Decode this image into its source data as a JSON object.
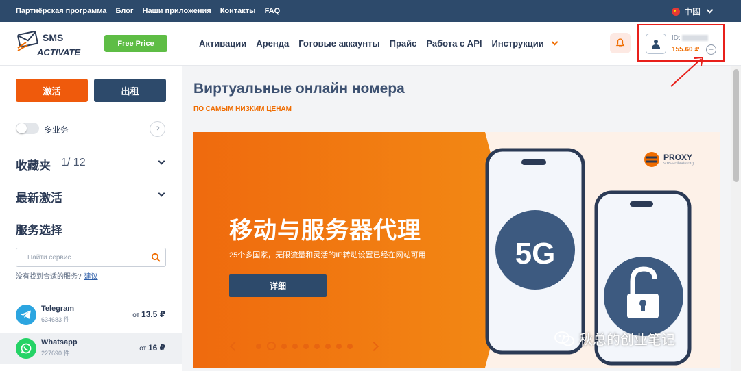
{
  "topbar": {
    "links": [
      "Партнёрская программа",
      "Блог",
      "Наши приложения",
      "Контакты",
      "FAQ"
    ],
    "language": "中國"
  },
  "header": {
    "logo_text": "SMS ACTIVATE",
    "free_price": "Free Price",
    "nav": [
      "Активации",
      "Аренда",
      "Готовые аккаунты",
      "Прайс",
      "Работа с API",
      "Инструкции"
    ],
    "account": {
      "id_label": "ID:",
      "balance": "155.60 ₽",
      "plus": "+"
    }
  },
  "sidebar": {
    "activate_label": "激活",
    "rent_label": "出租",
    "multi_service_label": "多业务",
    "help": "?",
    "favorites_title": "收藏夹",
    "favorites_count": "1/ 12",
    "recent_title": "最新激活",
    "service_select_title": "服务选择",
    "search_placeholder": "Найти сервис",
    "not_found_text": "没有找到合适的服务?",
    "suggest_link": "建议",
    "services": [
      {
        "name": "Telegram",
        "count": "634683 件",
        "price_prefix": "от",
        "price": "13.5 ₽"
      },
      {
        "name": "Whatsapp",
        "count": "227690 件",
        "price_prefix": "от",
        "price": "16 ₽"
      }
    ]
  },
  "main": {
    "title": "Виртуальные онлайн номера",
    "subtitle": "ПО САМЫМ НИЗКИМ ЦЕНАМ",
    "banner": {
      "title": "移动与服务器代理",
      "description": "25个多国家，无限流量和灵活的IP转动设置已经在网站可用",
      "button": "详细",
      "proxy_brand": "PROXY",
      "proxy_url": "sms-activate.org",
      "phone_label": "5G",
      "slide_count": 9,
      "active_slide": 2
    }
  },
  "watermark": "秋总的创业笔记",
  "colors": {
    "topbar": "#2d4a6b",
    "orange": "#ef5a0c",
    "green": "#5ebd45",
    "highlight": "#e8201b"
  }
}
